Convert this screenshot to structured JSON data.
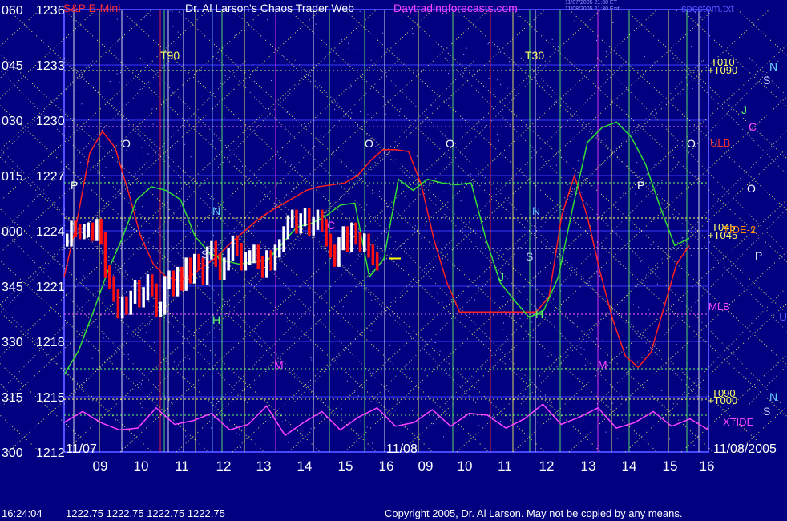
{
  "header": {
    "instrument": "S&P E-Mini",
    "title": "Dr. Al Larson's Chaos Trader Web",
    "site": "Daytradingforecasts.com",
    "stamp1": "11/07/2005 21:30 ET",
    "stamp2": "11/08/2005 21:30 Exit",
    "file": "spcctom.txt"
  },
  "footer": {
    "time": "16:24:04",
    "quotes": "1222.75 1222.75 1222.75 1222.75",
    "copyright": "Copyright 2005, Dr. Al Larson. May not be copied by any means."
  },
  "chart_data": {
    "type": "line",
    "title": "S&P E-Mini",
    "ylim": [
      1212,
      1236
    ],
    "y_ticks": [
      {
        "angle": "060",
        "price": "1236",
        "value": 1236
      },
      {
        "angle": "045",
        "price": "1233",
        "value": 1233
      },
      {
        "angle": "030",
        "price": "1230",
        "value": 1230
      },
      {
        "angle": "015",
        "price": "1227",
        "value": 1227
      },
      {
        "angle": "000",
        "price": "1224",
        "value": 1224
      },
      {
        "angle": "345",
        "price": "1221",
        "value": 1221
      },
      {
        "angle": "330",
        "price": "1218",
        "value": 1218
      },
      {
        "angle": "315",
        "price": "1215",
        "value": 1215
      },
      {
        "angle": "300",
        "price": "1212",
        "value": 1212
      }
    ],
    "x_ticks": [
      "09",
      "10",
      "11",
      "12",
      "13",
      "14",
      "15",
      "16",
      "09",
      "10",
      "11",
      "12",
      "13",
      "14",
      "15",
      "16"
    ],
    "date_labels": [
      "11/07",
      "11/08",
      "11/08/2005"
    ],
    "right_labels": [
      {
        "text": "T010",
        "color": "#ffff66"
      },
      {
        "text": "+T090",
        "color": "#ffff66"
      },
      {
        "text": "ULB",
        "color": "#ff3030"
      },
      {
        "text": "T045",
        "color": "#ffff66"
      },
      {
        "text": "+T045",
        "color": "#ffff66"
      },
      {
        "text": "TIDE-2",
        "color": "#ff8800"
      },
      {
        "text": "MLB",
        "color": "#ff44ff"
      },
      {
        "text": "T090",
        "color": "#ffff66"
      },
      {
        "text": "+T000",
        "color": "#ffff66"
      },
      {
        "text": "XTIDE",
        "color": "#ff44ff"
      }
    ],
    "planet_labels": [
      "N",
      "S",
      "J",
      "C",
      "O",
      "P",
      "U",
      "N",
      "S"
    ],
    "chart_labels": [
      "T90",
      "T30",
      "O",
      "O",
      "O",
      "O",
      "P",
      "P",
      "N",
      "N",
      "H",
      "H",
      "M",
      "M",
      "J",
      "S",
      "S",
      "C"
    ],
    "series": {
      "bars": [
        1223.5,
        1224.2,
        1224,
        1223.9,
        1224,
        1224.1,
        1223.8,
        1224.3,
        1223.6,
        1221.8,
        1221.2,
        1220.5,
        1219.6,
        1220.1,
        1219.8,
        1220.4,
        1221,
        1220.2,
        1220.6,
        1221.3,
        1220.8,
        1219.7,
        1219.8,
        1221.2,
        1221.5,
        1220.8,
        1221.7,
        1221.1,
        1222.2,
        1221.5,
        1222.4,
        1222.2,
        1221.4,
        1222.8,
        1223.1,
        1222.4,
        1221.7,
        1222.2,
        1222.7,
        1223.4,
        1223,
        1222.2,
        1222.5,
        1222.6,
        1222.9,
        1222.3,
        1221.8,
        1222.6,
        1222.2,
        1222.9,
        1223.2,
        1223.9,
        1224.5,
        1224.8,
        1224.2,
        1224.6,
        1224.9,
        1224.1,
        1224.4,
        1224.8,
        1224.3,
        1223.5,
        1222.9,
        1222.4,
        1223.3,
        1223.9,
        1223.2,
        1224.1,
        1223.6,
        1223.2,
        1223.5,
        1222.9,
        1222.5,
        1222.2
      ],
      "forecast_red": [
        1221.5,
        1224.5,
        1228.2,
        1229.4,
        1228.5,
        1226.2,
        1223.7,
        1222.2,
        1221.5,
        1221.3,
        1221.6,
        1222.1,
        1222.6,
        1223.3,
        1223.9,
        1224.5,
        1225,
        1225.4,
        1225.8,
        1226.2,
        1226.4,
        1226.5,
        1226.6,
        1227,
        1227.8,
        1228.4,
        1228.4,
        1228.3,
        1226.5,
        1223.5,
        1221.2,
        1219.6,
        1219.6,
        1219.6,
        1219.6,
        1219.6,
        1219.6,
        1219.6,
        1220.4,
        1224.8,
        1227,
        1224.8,
        1221.8,
        1219.2,
        1217.2,
        1216.6,
        1217.4,
        1219.8,
        1222.2,
        1223.2
      ],
      "forecast_green": [
        1216.2,
        1217.5,
        1219.6,
        1221.8,
        1223.6,
        1225.7,
        1226.4,
        1226.2,
        1225.7,
        1223.7,
        1222.8,
        1222.4,
        1222.2,
        1222.3,
        1222.4,
        1223.3,
        1224.2,
        1224.4,
        1224.8,
        1225.4,
        1225.5,
        1221.5,
        1222.5,
        1226.8,
        1226.2,
        1226.8,
        1226.6,
        1226.5,
        1226.6,
        1223.6,
        1221.2,
        1220.2,
        1219.3,
        1219.7,
        1221.5,
        1225.3,
        1228.8,
        1229.6,
        1229.9,
        1229.1,
        1227.6,
        1225.3,
        1223.2,
        1223.6
      ],
      "xtide": [
        1213.6,
        1214.2,
        1213.6,
        1213.2,
        1213.3,
        1214.4,
        1213.5,
        1213.7,
        1214.1,
        1213.2,
        1213.5,
        1214.5,
        1212.9,
        1213.6,
        1214.2,
        1213.2,
        1213.9,
        1214.4,
        1213.4,
        1213.6,
        1214.3,
        1213.4,
        1214.1,
        1214,
        1213.3,
        1213.8,
        1214.6,
        1213.5,
        1213.9,
        1214.4,
        1213.3,
        1213.6,
        1214.2,
        1213.4,
        1213.8,
        1213.2
      ]
    }
  }
}
